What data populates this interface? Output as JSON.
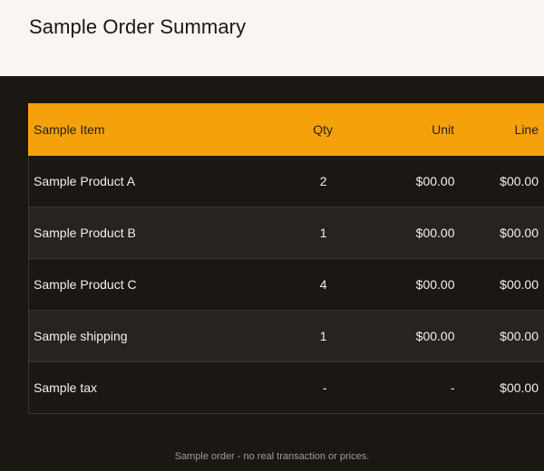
{
  "page": {
    "title": "Sample Order Summary"
  },
  "table": {
    "headers": {
      "item": "Sample Item",
      "qty": "Qty",
      "unit": "Unit",
      "line": "Line"
    },
    "rows": [
      {
        "item": "Sample Product A",
        "qty": "2",
        "unit": "$00.00",
        "line": "$00.00"
      },
      {
        "item": "Sample Product B",
        "qty": "1",
        "unit": "$00.00",
        "line": "$00.00"
      },
      {
        "item": "Sample Product C",
        "qty": "4",
        "unit": "$00.00",
        "line": "$00.00"
      },
      {
        "item": "Sample shipping",
        "qty": "1",
        "unit": "$00.00",
        "line": "$00.00"
      },
      {
        "item": "Sample tax",
        "qty": "-",
        "unit": "-",
        "line": "$00.00"
      }
    ]
  },
  "footer": {
    "note": "Sample order - no real transaction or prices."
  },
  "colors": {
    "header_bg": "#f9f6f2",
    "page_bg": "#1b1713",
    "table_header_bg": "#f5a10b",
    "row_alt_bg": "#262320",
    "text": "#f3efe9"
  }
}
